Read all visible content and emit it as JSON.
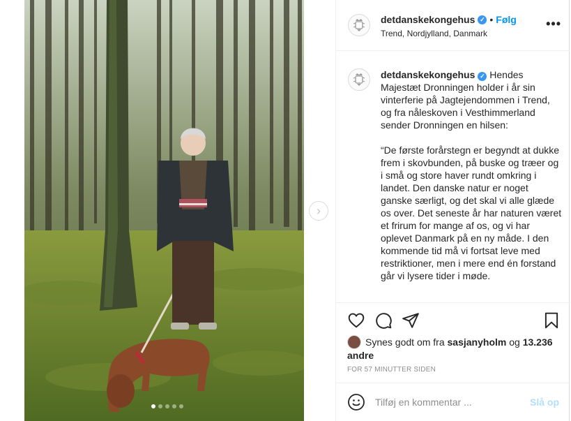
{
  "header": {
    "username": "detdanskekongehus",
    "verified_mark": "✓",
    "separator": "•",
    "follow_label": "Følg",
    "location": "Trend, Nordjylland, Danmark",
    "more_icon": "•••"
  },
  "media": {
    "next_icon": "›",
    "carousel_count": 5,
    "carousel_active": 0
  },
  "caption": {
    "username": "detdanskekongehus",
    "text": " Hendes Majestæt Dronningen holder i år sin vinterferie på Jagtejendommen i Trend, og fra nåleskoven i Vesthimmerland sender Dronningen en hilsen:\n\n“De første forårstegn er begyndt at dukke frem i skovbunden, på buske og træer og i små og store haver rundt omkring i landet. Den danske natur er noget ganske særligt, og det skal vi alle glæde os over. Det seneste år har naturen været et frirum for mange af os, og vi har oplevet Danmark på en ny måde. I den kommende tid må vi fortsat leve med restriktioner, men i mere end én forstand går vi lysere tider i møde."
  },
  "actions": {
    "like_icon": "heart-icon",
    "comment_icon": "comment-icon",
    "share_icon": "share-icon",
    "save_icon": "bookmark-icon"
  },
  "likes": {
    "prefix": "Synes godt om fra ",
    "user": "sasjanyholm",
    "middle": " og ",
    "count": "13.236 andre"
  },
  "timestamp": "For 57 minutter siden",
  "comment": {
    "placeholder": "Tilføj en kommentar ...",
    "post_label": "Slå op",
    "emoji_icon": "smiley-icon"
  },
  "colors": {
    "accent": "#0095f6",
    "post_disabled": "#b2dffc",
    "verified": "#3897f0",
    "muted": "#8e8e8e"
  }
}
